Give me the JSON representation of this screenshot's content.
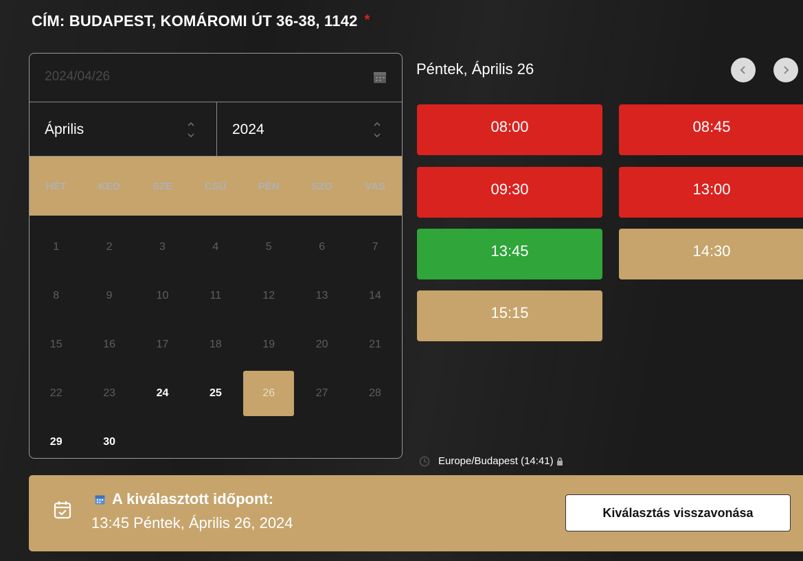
{
  "address": {
    "label": "CÍM: BUDAPEST, KOMÁROMI ÚT 36-38, 1142",
    "required_marker": "*"
  },
  "calendar": {
    "date_value": "2024/04/26",
    "month": "Április",
    "year": "2024",
    "weekdays": [
      "HÉT",
      "KED",
      "SZE",
      "CSÜ",
      "PÉN",
      "SZO",
      "VAS"
    ],
    "weeks": [
      [
        "1",
        "2",
        "3",
        "4",
        "5",
        "6",
        "7"
      ],
      [
        "8",
        "9",
        "10",
        "11",
        "12",
        "13",
        "14"
      ],
      [
        "15",
        "16",
        "17",
        "18",
        "19",
        "20",
        "21"
      ],
      [
        "22",
        "23",
        "24",
        "25",
        "26",
        "27",
        "28"
      ],
      [
        "29",
        "30",
        "",
        "",
        "",
        "",
        ""
      ]
    ],
    "available_days": [
      "24",
      "25",
      "26",
      "29",
      "30"
    ],
    "selected_day": "26"
  },
  "day_header": "Péntek, Április 26",
  "slots": [
    {
      "time": "08:00",
      "status": "booked"
    },
    {
      "time": "08:45",
      "status": "booked"
    },
    {
      "time": "09:30",
      "status": "booked"
    },
    {
      "time": "13:00",
      "status": "booked"
    },
    {
      "time": "13:45",
      "status": "selected"
    },
    {
      "time": "14:30",
      "status": "free"
    },
    {
      "time": "15:15",
      "status": "free"
    }
  ],
  "timezone": "Europe/Budapest (14:41)",
  "selection": {
    "heading": "A kiválasztott időpont:",
    "value": "13:45 Péntek, Április 26, 2024",
    "undo_label": "Kiválasztás visszavonása"
  },
  "colors": {
    "booked": "#d9231f",
    "selected": "#2fa53a",
    "free": "#c6a46c",
    "accent": "#c6a46c"
  }
}
